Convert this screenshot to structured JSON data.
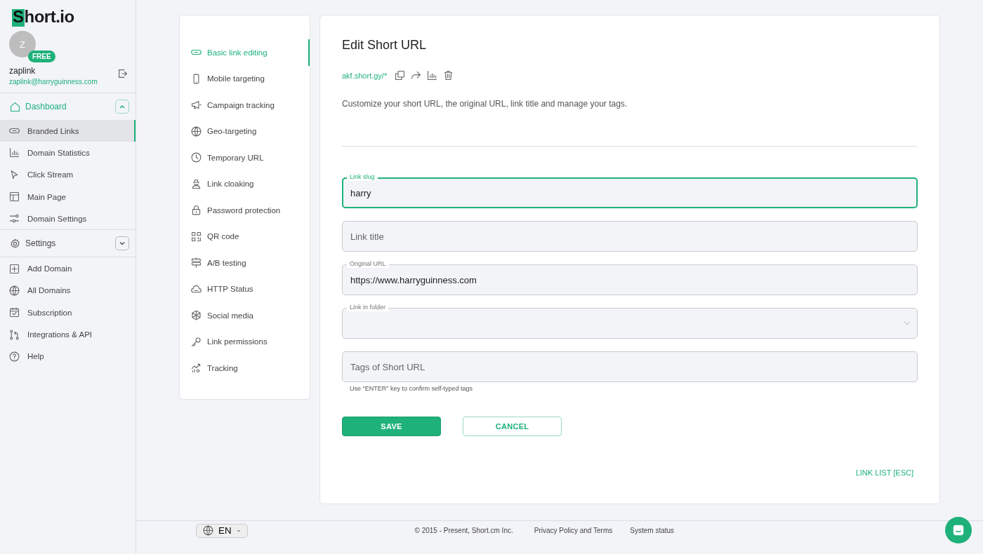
{
  "brand": {
    "logo_letter": "S",
    "logo_rest": "hort.io"
  },
  "user": {
    "avatar_letter": "Z",
    "plan": "FREE",
    "name": "zaplink",
    "email": "zaplink@harryguinness.com"
  },
  "sidebar": {
    "sections": [
      {
        "label": "Dashboard",
        "expanded": true,
        "items": [
          {
            "label": "Branded Links",
            "selected": true
          },
          {
            "label": "Domain Statistics",
            "selected": false
          },
          {
            "label": "Click Stream",
            "selected": false
          },
          {
            "label": "Main Page",
            "selected": false
          },
          {
            "label": "Domain Settings",
            "selected": false
          }
        ]
      },
      {
        "label": "Settings",
        "expanded": false
      }
    ],
    "links": [
      {
        "label": "Add Domain"
      },
      {
        "label": "All Domains"
      },
      {
        "label": "Subscription"
      },
      {
        "label": "Integrations & API"
      },
      {
        "label": "Help"
      }
    ]
  },
  "editor_nav": [
    {
      "label": "Basic link editing",
      "selected": true
    },
    {
      "label": "Mobile targeting",
      "selected": false
    },
    {
      "label": "Campaign tracking",
      "selected": false
    },
    {
      "label": "Geo-targeting",
      "selected": false
    },
    {
      "label": "Temporary URL",
      "selected": false
    },
    {
      "label": "Link cloaking",
      "selected": false
    },
    {
      "label": "Password protection",
      "selected": false
    },
    {
      "label": "QR code",
      "selected": false
    },
    {
      "label": "A/B testing",
      "selected": false
    },
    {
      "label": "HTTP Status",
      "selected": false
    },
    {
      "label": "Social media",
      "selected": false
    },
    {
      "label": "Link permissions",
      "selected": false
    },
    {
      "label": "Tracking",
      "selected": false
    }
  ],
  "editor": {
    "title": "Edit Short URL",
    "short_link": "akf.short.gy/*",
    "description": "Customize your short URL, the original URL, link title and manage your tags.",
    "fields": [
      {
        "kind": "text",
        "label": "Link slug",
        "value": "harry",
        "focused": true
      },
      {
        "kind": "text",
        "placeholder": "Link title",
        "focused": false
      },
      {
        "kind": "text",
        "label": "Original URL",
        "value": "https://www.harryguinness.com",
        "focused": false
      },
      {
        "kind": "select",
        "label": "Link in folder",
        "focused": false
      },
      {
        "kind": "text",
        "placeholder": "Tags of Short URL",
        "hint": "Use \"ENTER\" key to confirm self-typed tags",
        "focused": false
      }
    ],
    "buttons": [
      {
        "kind": "primary",
        "label": "SAVE"
      },
      {
        "kind": "secondary",
        "label": "CANCEL"
      }
    ],
    "back_link": "LINK LIST [ESC]"
  },
  "footer": {
    "language": "EN",
    "copyright": "© 2015 - Present, Short.cm Inc.",
    "links": [
      "Privacy Policy and Terms",
      "System status"
    ]
  }
}
